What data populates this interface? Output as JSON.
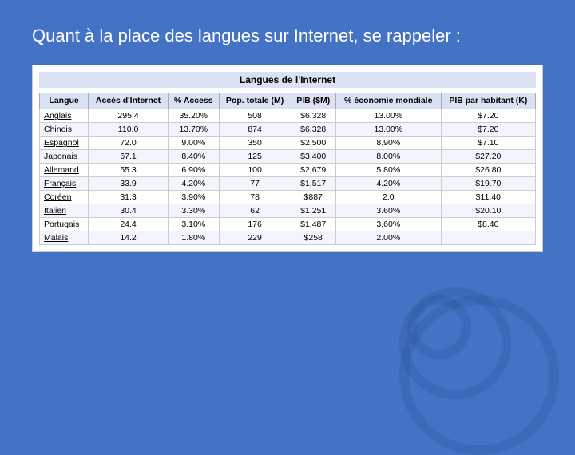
{
  "slide": {
    "title": "Quant à la place des langues sur Internet, se rappeler :",
    "table_title": "Langues de l'Internet",
    "columns": [
      {
        "label": "Langue"
      },
      {
        "label": "Accès d'Internct"
      },
      {
        "label": "% Access"
      },
      {
        "label": "Pop. totale (M)"
      },
      {
        "label": "PIB ($M)"
      },
      {
        "label": "% économie mondiale"
      },
      {
        "label": "PIB par habitant (K)"
      }
    ],
    "rows": [
      {
        "langue": "Anglais",
        "acces": "295.4",
        "pct_access": "35.20%",
        "pop": "508",
        "pib": "$6,328",
        "pct_eco": "13.00%",
        "pib_hab": "$7.20"
      },
      {
        "langue": "Chinois",
        "acces": "110.0",
        "pct_access": "13.70%",
        "pop": "874",
        "pib": "$6,328",
        "pct_eco": "13.00%",
        "pib_hab": "$7.20"
      },
      {
        "langue": "Espagnol",
        "acces": "72.0",
        "pct_access": "9.00%",
        "pop": "350",
        "pib": "$2,500",
        "pct_eco": "8.90%",
        "pib_hab": "$7.10"
      },
      {
        "langue": "Japonais",
        "acces": "67.1",
        "pct_access": "8.40%",
        "pop": "125",
        "pib": "$3,400",
        "pct_eco": "8.00%",
        "pib_hab": "$27.20"
      },
      {
        "langue": "Allemand",
        "acces": "55.3",
        "pct_access": "6.90%",
        "pop": "100",
        "pib": "$2,679",
        "pct_eco": "5.80%",
        "pib_hab": "$26.80"
      },
      {
        "langue": "Français",
        "acces": "33.9",
        "pct_access": "4.20%",
        "pop": "77",
        "pib": "$1,517",
        "pct_eco": "4.20%",
        "pib_hab": "$19.70"
      },
      {
        "langue": "Coréen",
        "acces": "31.3",
        "pct_access": "3.90%",
        "pop": "78",
        "pib": "$887",
        "pct_eco": "2.0",
        "pib_hab": "$11.40"
      },
      {
        "langue": "Italien",
        "acces": "30.4",
        "pct_access": "3.30%",
        "pop": "62",
        "pib": "$1,251",
        "pct_eco": "3.60%",
        "pib_hab": "$20.10"
      },
      {
        "langue": "Portugais",
        "acces": "24.4",
        "pct_access": "3.10%",
        "pop": "176",
        "pib": "$1,487",
        "pct_eco": "3.60%",
        "pib_hab": "$8.40"
      },
      {
        "langue": "Malais",
        "acces": "14.2",
        "pct_access": "1.80%",
        "pop": "229",
        "pib": "$258",
        "pct_eco": "2.00%",
        "pib_hab": ""
      }
    ]
  }
}
